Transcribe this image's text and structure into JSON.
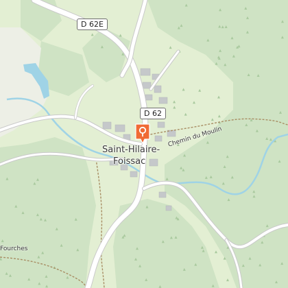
{
  "map": {
    "road_labels": {
      "d62e": "D 62E",
      "d62": "D 62"
    },
    "place_label": {
      "line1": "Saint-Hilaire-",
      "line2": "Foissac"
    },
    "path_labels": {
      "chemin_du_moulin": "Chemin du Moulin",
      "fourches": "Fourches"
    },
    "marker": {
      "icon": "map-pin-icon",
      "color": "#f06a35"
    },
    "colors": {
      "forest": "#cfe3c4",
      "meadow": "#e3efd3",
      "clearing": "#edefe6",
      "water": "#9fd3e6",
      "road": "#ffffff",
      "buildings": "#c5c8ca",
      "trail": "#a88d63"
    }
  }
}
